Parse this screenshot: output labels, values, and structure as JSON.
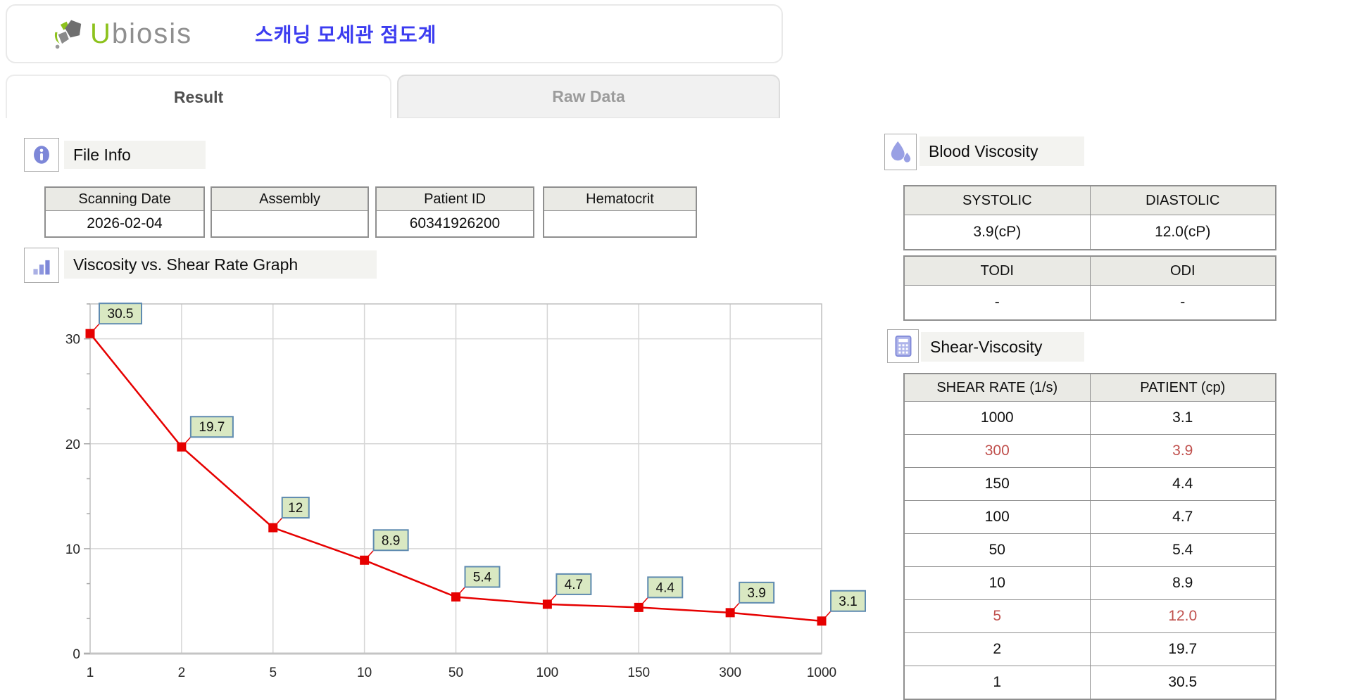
{
  "header": {
    "logo": {
      "accent": "U",
      "rest": "biosis"
    },
    "app_title": "스캐닝 모세관 점도계"
  },
  "tabs": [
    {
      "label": "Result",
      "active": true
    },
    {
      "label": "Raw Data",
      "active": false
    }
  ],
  "sections": {
    "file_info": {
      "title": "File Info",
      "icon": "info-icon"
    },
    "graph": {
      "title": "Viscosity vs. Shear Rate Graph",
      "icon": "bar-chart-icon"
    },
    "blood_viscosity": {
      "title": "Blood Viscosity",
      "icon": "droplets-icon"
    },
    "shear_viscosity": {
      "title": "Shear-Viscosity",
      "icon": "calculator-icon"
    }
  },
  "file_info_fields": [
    {
      "label": "Scanning Date",
      "value": "2026-02-04"
    },
    {
      "label": "Assembly",
      "value": ""
    },
    {
      "label": "Patient ID",
      "value": "60341926200"
    },
    {
      "label": "Hematocrit",
      "value": ""
    }
  ],
  "blood_viscosity_table": {
    "headers": [
      "SYSTOLIC",
      "DIASTOLIC"
    ],
    "values": [
      "3.9(cP)",
      "12.0(cP)"
    ]
  },
  "oxygen_index_table": {
    "headers": [
      "TODI",
      "ODI"
    ],
    "values": [
      "-",
      "-"
    ]
  },
  "shear_viscosity_table": {
    "headers": [
      "SHEAR RATE (1/s)",
      "PATIENT (cp)"
    ],
    "rows": [
      {
        "shear_rate": "1000",
        "patient": "3.1",
        "highlight": false
      },
      {
        "shear_rate": "300",
        "patient": "3.9",
        "highlight": true
      },
      {
        "shear_rate": "150",
        "patient": "4.4",
        "highlight": false
      },
      {
        "shear_rate": "100",
        "patient": "4.7",
        "highlight": false
      },
      {
        "shear_rate": "50",
        "patient": "5.4",
        "highlight": false
      },
      {
        "shear_rate": "10",
        "patient": "8.9",
        "highlight": false
      },
      {
        "shear_rate": "5",
        "patient": "12.0",
        "highlight": true
      },
      {
        "shear_rate": "2",
        "patient": "19.7",
        "highlight": false
      },
      {
        "shear_rate": "1",
        "patient": "30.5",
        "highlight": false
      }
    ]
  },
  "chart_data": {
    "type": "line",
    "title": "Viscosity vs. Shear Rate Graph",
    "x_categories": [
      "1",
      "2",
      "5",
      "10",
      "50",
      "100",
      "150",
      "300",
      "1000"
    ],
    "values": [
      30.5,
      19.7,
      12,
      8.9,
      5.4,
      4.7,
      4.4,
      3.9,
      3.1
    ],
    "point_labels": [
      "30.5",
      "19.7",
      "12",
      "8.9",
      "5.4",
      "4.7",
      "4.4",
      "3.9",
      "3.1"
    ],
    "xlabel": "",
    "ylabel": "",
    "ylim": [
      0,
      33.33
    ],
    "y_major_ticks": [
      0,
      10,
      20,
      30
    ],
    "grid": true,
    "legend": false,
    "series_name": "PATIENT (cp)",
    "colors": {
      "series": "#e60000",
      "label_fill": "#d9e8c2",
      "label_border": "#5f8bb0"
    }
  },
  "colors": {
    "brand_green": "#8dc21d",
    "title_blue": "#3c3cf0",
    "highlight_red": "#c0504d",
    "section_icon_blue": "#7d87d8"
  }
}
